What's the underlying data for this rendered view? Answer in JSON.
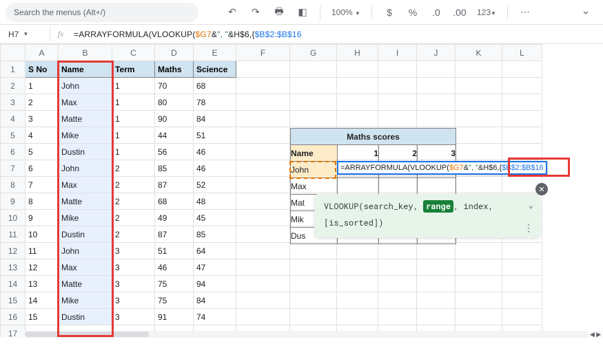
{
  "menu": {
    "search_placeholder": "Search the menus (Alt+/)",
    "zoom": "100%",
    "fmt": "123"
  },
  "fbar": {
    "cell": "H7",
    "p1": "=ARRAYFORMULA(VLOOKUP(",
    "ref1": "$G7",
    "p2": "&",
    "str": "\", \"",
    "p3": "&H$6,{",
    "ref2": "$B$2:$B$16"
  },
  "cols": [
    "",
    "A",
    "B",
    "C",
    "D",
    "E",
    "F",
    "G",
    "H",
    "I",
    "J",
    "K",
    "L"
  ],
  "headers": {
    "a": "S No",
    "b": "Name",
    "c": "Term",
    "d": "Maths",
    "e": "Science"
  },
  "rows": [
    {
      "n": 1,
      "name": "John",
      "t": 1,
      "m": 70,
      "s": 68
    },
    {
      "n": 2,
      "name": "Max",
      "t": 1,
      "m": 80,
      "s": 78
    },
    {
      "n": 3,
      "name": "Matte",
      "t": 1,
      "m": 90,
      "s": 84
    },
    {
      "n": 4,
      "name": "Mike",
      "t": 1,
      "m": 44,
      "s": 51
    },
    {
      "n": 5,
      "name": "Dustin",
      "t": 1,
      "m": 56,
      "s": 46
    },
    {
      "n": 6,
      "name": "John",
      "t": 2,
      "m": 85,
      "s": 46
    },
    {
      "n": 7,
      "name": "Max",
      "t": 2,
      "m": 87,
      "s": 52
    },
    {
      "n": 8,
      "name": "Matte",
      "t": 2,
      "m": 68,
      "s": 48
    },
    {
      "n": 9,
      "name": "Mike",
      "t": 2,
      "m": 49,
      "s": 45
    },
    {
      "n": 10,
      "name": "Dustin",
      "t": 2,
      "m": 87,
      "s": 85
    },
    {
      "n": 11,
      "name": "John",
      "t": 3,
      "m": 51,
      "s": 64
    },
    {
      "n": 12,
      "name": "Max",
      "t": 3,
      "m": 46,
      "s": 47
    },
    {
      "n": 13,
      "name": "Matte",
      "t": 3,
      "m": 75,
      "s": 94
    },
    {
      "n": 14,
      "name": "Mike",
      "t": 3,
      "m": 75,
      "s": 84
    },
    {
      "n": 15,
      "name": "Dustin",
      "t": 3,
      "m": 91,
      "s": 74
    }
  ],
  "maths": {
    "title": "Maths scores",
    "nameh": "Name",
    "cols": {
      "c1": "1",
      "c2": "2",
      "c3": "3"
    },
    "names": [
      "John",
      "Max",
      "Mat",
      "Mik",
      "Dus"
    ],
    "names_full": {
      "r1": "John",
      "r2": "Max",
      "r3": "Matte",
      "r4": "Mike",
      "r5": "Dustin"
    }
  },
  "tip": {
    "p1": "VLOOKUP(search_key, ",
    "range": "range",
    "p2": ", index,",
    "p3": "[is_sorted])"
  }
}
